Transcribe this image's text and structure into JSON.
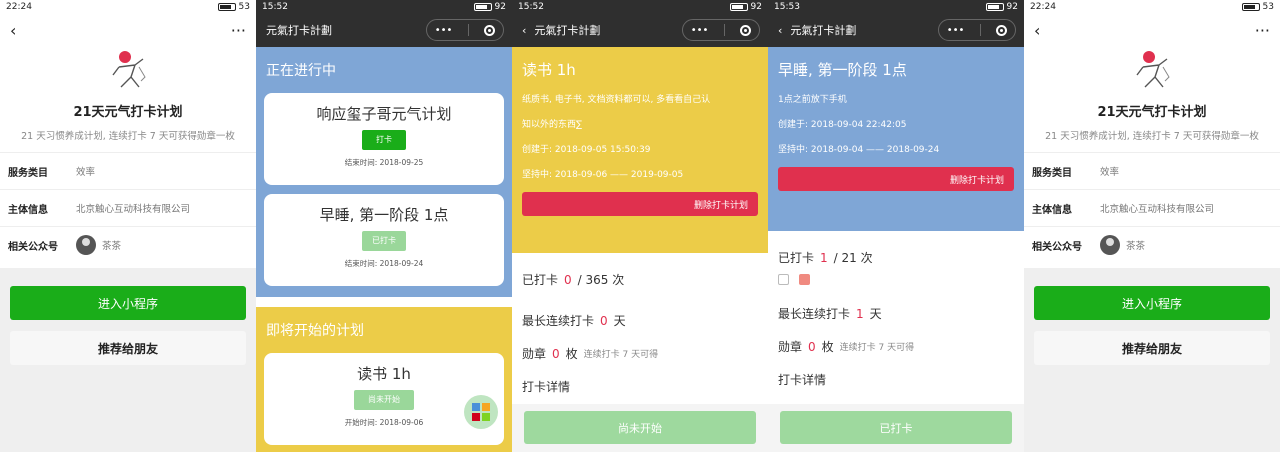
{
  "colors": {
    "wechat_green": "#1aad19",
    "blue": "#7fa6d6",
    "yellow": "#eccc48",
    "red": "#e0304e",
    "pale_green": "#9ed99e"
  },
  "p1": {
    "status_time": "22:24",
    "battery": "53",
    "title": "21天元气打卡计划",
    "subtitle": "21 天习惯养成计划, 连续打卡 7 天可获得勋章一枚",
    "rows": [
      {
        "key": "服务类目",
        "value": "效率"
      },
      {
        "key": "主体信息",
        "value": "北京触心互动科技有限公司"
      },
      {
        "key": "相关公众号",
        "value": "茶茶"
      }
    ],
    "enter_btn": "进入小程序",
    "recommend_btn": "推荐给朋友"
  },
  "p2": {
    "status_time": "15:52",
    "battery": "92",
    "app_title": "元氣打卡計劃",
    "ongoing_title": "正在进行中",
    "cards": [
      {
        "title": "响应玺子哥元气计划",
        "btn": "打卡",
        "time": "结束时间: 2018-09-25"
      },
      {
        "title": "早睡, 第一阶段 1点",
        "btn": "已打卡",
        "time": "结束时间: 2018-09-24"
      }
    ],
    "upcoming_title": "即将开始的计划",
    "upcoming": {
      "title": "读书 1h",
      "btn": "尚未开始",
      "time": "开始时间: 2018-09-06"
    }
  },
  "p3": {
    "status_time": "15:52",
    "battery": "92",
    "app_title": "元氣打卡計劃",
    "title": "读书 1h",
    "desc1": "纸质书, 电子书, 文档资料都可以, 多看看自己认",
    "desc2": "知以外的东西∑",
    "created": "创建于: 2018-09-05 15:50:39",
    "duration": "坚持中: 2018-09-06 —— 2019-09-05",
    "delete_btn": "删除打卡计划",
    "checked_label": "已打卡",
    "checked_count": "0",
    "checked_total": "/ 365 次",
    "streak_label": "最长连续打卡",
    "streak_value": "0",
    "streak_unit": "天",
    "medal_label": "勋章",
    "medal_value": "0",
    "medal_unit": "枚",
    "medal_hint": "连续打卡 7 天可得",
    "detail_label": "打卡详情",
    "bottom_btn": "尚未开始"
  },
  "p4": {
    "status_time": "15:53",
    "battery": "92",
    "app_title": "元氣打卡計劃",
    "title": "早睡, 第一阶段 1点",
    "desc1": "1点之前放下手机",
    "created": "创建于: 2018-09-04 22:42:05",
    "duration": "坚持中: 2018-09-04 —— 2018-09-24",
    "delete_btn": "删除打卡计划",
    "checked_label": "已打卡",
    "checked_count": "1",
    "checked_total": "/ 21 次",
    "streak_label": "最长连续打卡",
    "streak_value": "1",
    "streak_unit": "天",
    "medal_label": "勋章",
    "medal_value": "0",
    "medal_unit": "枚",
    "medal_hint": "连续打卡 7 天可得",
    "detail_label": "打卡详情",
    "bottom_btn": "已打卡"
  },
  "p5": {
    "status_time": "22:24",
    "battery": "53",
    "title": "21天元气打卡计划",
    "subtitle": "21 天习惯养成计划, 连续打卡 7 天可获得勋章一枚",
    "rows": [
      {
        "key": "服务类目",
        "value": "效率"
      },
      {
        "key": "主体信息",
        "value": "北京触心互动科技有限公司"
      },
      {
        "key": "相关公众号",
        "value": "茶茶"
      }
    ],
    "enter_btn": "进入小程序",
    "recommend_btn": "推荐给朋友"
  }
}
